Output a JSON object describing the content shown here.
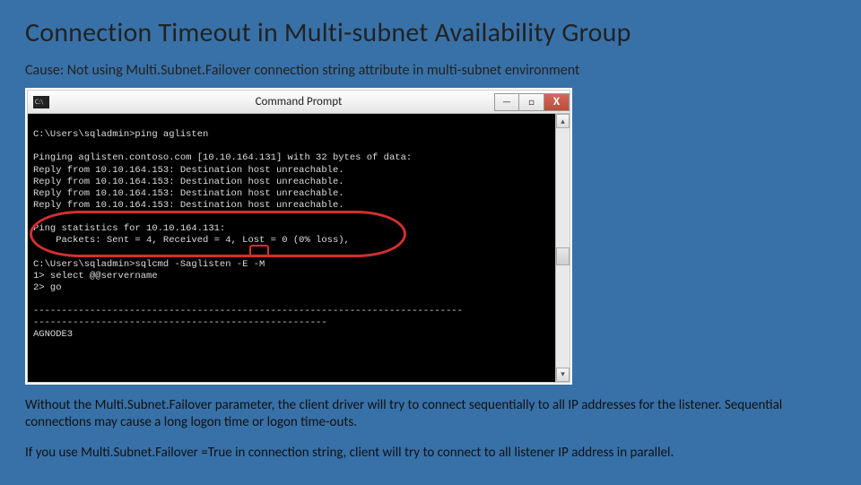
{
  "title": "Connection Timeout in Multi-subnet  Availability Group",
  "cause": "Cause: Not using Multi.Subnet.Failover connection string attribute in multi-subnet environment",
  "cmd": {
    "window_title": "Command Prompt",
    "icon_text": "C:\\",
    "btn_min": "—",
    "btn_max": "□",
    "btn_close": "X",
    "scroll_up": "▴",
    "scroll_down": "▾",
    "line_prompt1": "C:\\Users\\sqladmin>ping aglisten",
    "line_blank1": "",
    "line_pinghdr": "Pinging aglisten.contoso.com [10.10.164.131] with 32 bytes of data:",
    "line_r1": "Reply from 10.10.164.153: Destination host unreachable.",
    "line_r2": "Reply from 10.10.164.153: Destination host unreachable.",
    "line_r3": "Reply from 10.10.164.153: Destination host unreachable.",
    "line_r4": "Reply from 10.10.164.153: Destination host unreachable.",
    "line_blank2": "",
    "line_stats1": "Ping statistics for 10.10.164.131:",
    "line_stats2": "    Packets: Sent = 4, Received = 4, Lost = 0 (0% loss),",
    "line_blank3": "",
    "line_sqlcmd": "C:\\Users\\sqladmin>sqlcmd -Saglisten -E -M",
    "line_sel": "1> select @@servername",
    "line_go": "2> go",
    "line_blank4": "",
    "line_dash1": "----------------------------------------------------------------------------",
    "line_dash2": "----------------------------------------------------",
    "line_node": "AGNODE3"
  },
  "para1": "Without the Multi.Subnet.Failover parameter, the client driver will try to connect sequentially to all IP addresses for the listener. Sequential connections may cause a long logon time or logon time-outs.",
  "para2": "If you use Multi.Subnet.Failover =True in connection string, client will try to connect to all listener IP address in parallel."
}
